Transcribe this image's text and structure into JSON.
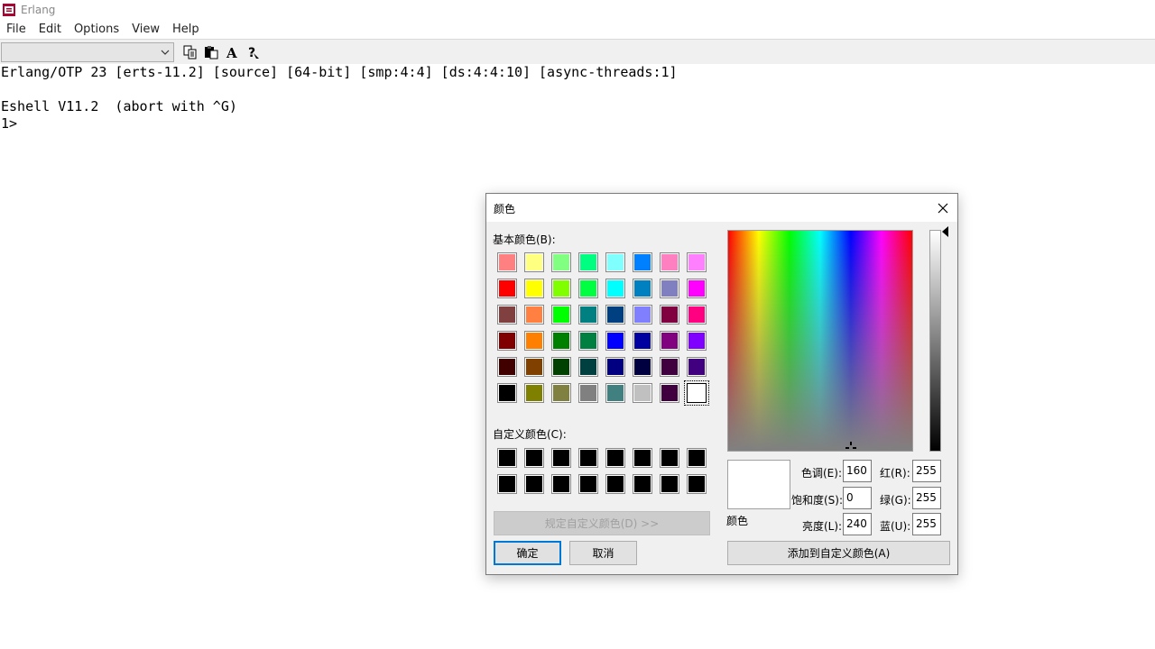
{
  "window": {
    "title": "Erlang"
  },
  "menu": [
    "File",
    "Edit",
    "Options",
    "View",
    "Help"
  ],
  "toolbar": {
    "combo_value": "",
    "buttons": [
      "copy-icon",
      "paste-icon",
      "font-icon",
      "help-icon"
    ]
  },
  "console": {
    "lines": [
      "Erlang/OTP 23 [erts-11.2] [source] [64-bit] [smp:4:4] [ds:4:4:10] [async-threads:1]",
      "",
      "Eshell V11.2  (abort with ^G)",
      "1>"
    ]
  },
  "dialog": {
    "title": "颜色",
    "basic_label": "基本颜色(B):",
    "custom_label": "自定义颜色(C):",
    "define_custom_button": "规定自定义颜色(D) >>",
    "ok_button": "确定",
    "cancel_button": "取消",
    "add_custom_button": "添加到自定义颜色(A)",
    "preview_label": "颜色",
    "basic_colors": [
      [
        "#ff8080",
        "#ffff80",
        "#80ff80",
        "#00ff80",
        "#80ffff",
        "#0080ff",
        "#ff80c0",
        "#ff80ff"
      ],
      [
        "#ff0000",
        "#ffff00",
        "#80ff00",
        "#00ff40",
        "#00ffff",
        "#0080c0",
        "#8080c0",
        "#ff00ff"
      ],
      [
        "#804040",
        "#ff8040",
        "#00ff00",
        "#008080",
        "#004080",
        "#8080ff",
        "#800040",
        "#ff0080"
      ],
      [
        "#800000",
        "#ff8000",
        "#008000",
        "#008040",
        "#0000ff",
        "#0000a0",
        "#800080",
        "#8000ff"
      ],
      [
        "#400000",
        "#804000",
        "#004000",
        "#004040",
        "#000080",
        "#000040",
        "#400040",
        "#400080"
      ],
      [
        "#000000",
        "#808000",
        "#808040",
        "#808080",
        "#408080",
        "#c0c0c0",
        "#400040",
        "#ffffff"
      ]
    ],
    "selected_basic": "#ffffff",
    "custom_colors": [
      [
        "#000000",
        "#000000",
        "#000000",
        "#000000",
        "#000000",
        "#000000",
        "#000000",
        "#000000"
      ],
      [
        "#000000",
        "#000000",
        "#000000",
        "#000000",
        "#000000",
        "#000000",
        "#000000",
        "#000000"
      ]
    ],
    "hue_label": "色调(E):",
    "hue": "160",
    "sat_label": "饱和度(S):",
    "sat": "0",
    "lum_label": "亮度(L):",
    "lum": "240",
    "red_label": "红(R):",
    "red": "255",
    "green_label": "绿(G):",
    "green": "255",
    "blue_label": "蓝(U):",
    "blue": "255"
  }
}
